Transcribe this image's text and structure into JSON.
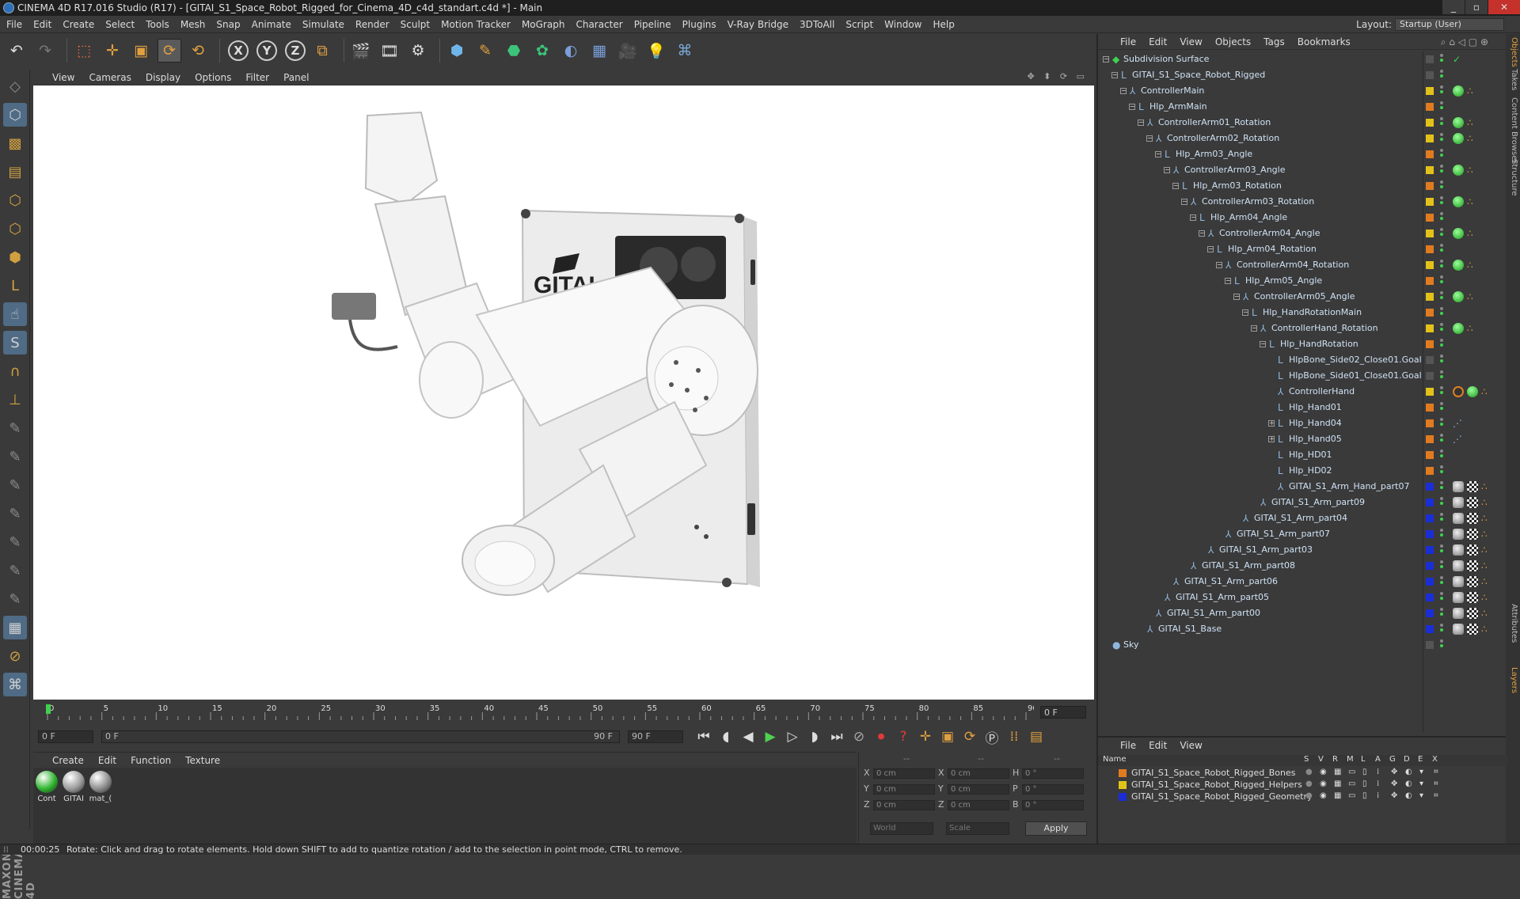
{
  "window": {
    "title": "CINEMA 4D R17.016 Studio (R17) - [GITAI_S1_Space_Robot_Rigged_for_Cinema_4D_c4d_standart.c4d *] - Main",
    "buttons": [
      "_",
      "▫",
      "✕"
    ]
  },
  "menubar": [
    "File",
    "Edit",
    "Create",
    "Select",
    "Tools",
    "Mesh",
    "Snap",
    "Animate",
    "Simulate",
    "Render",
    "Sculpt",
    "Motion Tracker",
    "MoGraph",
    "Character",
    "Pipeline",
    "Plugins",
    "V-Ray Bridge",
    "3DToAll",
    "Script",
    "Window",
    "Help"
  ],
  "layout": {
    "label": "Layout:",
    "value": "Startup (User)"
  },
  "viewport": {
    "menu": [
      "View",
      "Cameras",
      "Display",
      "Options",
      "Filter",
      "Panel"
    ],
    "icons": "✥ ⬍ ⟳ ▭"
  },
  "timeline": {
    "ticks": [
      "0",
      "5",
      "10",
      "15",
      "20",
      "25",
      "30",
      "35",
      "40",
      "45",
      "50",
      "55",
      "60",
      "65",
      "70",
      "75",
      "80",
      "85",
      "90"
    ],
    "end_frame": "0 F"
  },
  "transport": {
    "start": "0 F",
    "slider_left": "0 F",
    "slider_right": "90 F",
    "end": "90 F"
  },
  "materials": {
    "menu": [
      "Create",
      "Edit",
      "Function",
      "Texture"
    ],
    "items": [
      {
        "name": "Cont",
        "color": "#2fb52f"
      },
      {
        "name": "GITAI",
        "color": "#9a9a9a"
      },
      {
        "name": "mat_(",
        "color": "#8c8c8c"
      }
    ]
  },
  "coords": {
    "header": [
      "--",
      "--",
      "--"
    ],
    "rows": [
      {
        "a": "X",
        "av": "0 cm",
        "b": "X",
        "bv": "0 cm",
        "c": "H",
        "cv": "0 °"
      },
      {
        "a": "Y",
        "av": "0 cm",
        "b": "Y",
        "bv": "0 cm",
        "c": "P",
        "cv": "0 °"
      },
      {
        "a": "Z",
        "av": "0 cm",
        "b": "Z",
        "bv": "0 cm",
        "c": "B",
        "cv": "0 °"
      }
    ],
    "world": "World",
    "scale": "Scale",
    "apply": "Apply"
  },
  "status": {
    "time": "00:00:25",
    "text": "Rotate: Click and drag to rotate elements. Hold down SHIFT to add to quantize rotation / add to the selection in point mode, CTRL to remove."
  },
  "objects": {
    "menu": [
      "File",
      "Edit",
      "View",
      "Objects",
      "Tags",
      "Bookmarks"
    ],
    "rows": [
      {
        "name": "Subdivision Surface",
        "depth": 0,
        "toggle": "-",
        "icon": "◆",
        "layer": "",
        "tags": [
          "check"
        ]
      },
      {
        "name": "GITAI_S1_Space_Robot_Rigged",
        "depth": 1,
        "toggle": "-",
        "icon": "L",
        "layer": "",
        "tags": []
      },
      {
        "name": "ControllerMain",
        "depth": 2,
        "toggle": "-",
        "icon": "⅄",
        "layer": "#e2c21a",
        "tags": [
          "green",
          "dots"
        ]
      },
      {
        "name": "Hlp_ArmMain",
        "depth": 3,
        "toggle": "-",
        "icon": "L",
        "layer": "#e07b20",
        "tags": []
      },
      {
        "name": "ControllerArm01_Rotation",
        "depth": 4,
        "toggle": "-",
        "icon": "⅄",
        "layer": "#e2c21a",
        "tags": [
          "green",
          "dots"
        ]
      },
      {
        "name": "ControllerArm02_Rotation",
        "depth": 5,
        "toggle": "-",
        "icon": "⅄",
        "layer": "#e2c21a",
        "tags": [
          "green",
          "dots"
        ]
      },
      {
        "name": "Hlp_Arm03_Angle",
        "depth": 6,
        "toggle": "-",
        "icon": "L",
        "layer": "#e07b20",
        "tags": []
      },
      {
        "name": "ControllerArm03_Angle",
        "depth": 7,
        "toggle": "-",
        "icon": "⅄",
        "layer": "#e2c21a",
        "tags": [
          "green",
          "dots"
        ]
      },
      {
        "name": "Hlp_Arm03_Rotation",
        "depth": 8,
        "toggle": "-",
        "icon": "L",
        "layer": "#e07b20",
        "tags": []
      },
      {
        "name": "ControllerArm03_Rotation",
        "depth": 9,
        "toggle": "-",
        "icon": "⅄",
        "layer": "#e2c21a",
        "tags": [
          "green",
          "dots"
        ]
      },
      {
        "name": "Hlp_Arm04_Angle",
        "depth": 10,
        "toggle": "-",
        "icon": "L",
        "layer": "#e07b20",
        "tags": []
      },
      {
        "name": "ControllerArm04_Angle",
        "depth": 11,
        "toggle": "-",
        "icon": "⅄",
        "layer": "#e2c21a",
        "tags": [
          "green",
          "dots"
        ]
      },
      {
        "name": "Hlp_Arm04_Rotation",
        "depth": 12,
        "toggle": "-",
        "icon": "L",
        "layer": "#e07b20",
        "tags": []
      },
      {
        "name": "ControllerArm04_Rotation",
        "depth": 13,
        "toggle": "-",
        "icon": "⅄",
        "layer": "#e2c21a",
        "tags": [
          "green",
          "dots"
        ]
      },
      {
        "name": "Hlp_Arm05_Angle",
        "depth": 14,
        "toggle": "-",
        "icon": "L",
        "layer": "#e07b20",
        "tags": []
      },
      {
        "name": "ControllerArm05_Angle",
        "depth": 15,
        "toggle": "-",
        "icon": "⅄",
        "layer": "#e2c21a",
        "tags": [
          "green",
          "dots"
        ]
      },
      {
        "name": "Hlp_HandRotationMain",
        "depth": 16,
        "toggle": "-",
        "icon": "L",
        "layer": "#e07b20",
        "tags": []
      },
      {
        "name": "ControllerHand_Rotation",
        "depth": 17,
        "toggle": "-",
        "icon": "⅄",
        "layer": "#e2c21a",
        "tags": [
          "green",
          "dots"
        ]
      },
      {
        "name": "Hlp_HandRotation",
        "depth": 18,
        "toggle": "-",
        "icon": "L",
        "layer": "#e07b20",
        "tags": []
      },
      {
        "name": "HlpBone_Side02_Close01.Goal",
        "depth": 19,
        "toggle": "",
        "icon": "L",
        "layer": "",
        "tags": []
      },
      {
        "name": "HlpBone_Side01_Close01.Goal",
        "depth": 19,
        "toggle": "",
        "icon": "L",
        "layer": "",
        "tags": []
      },
      {
        "name": "ControllerHand",
        "depth": 19,
        "toggle": "",
        "icon": "⅄",
        "layer": "#e2c21a",
        "tags": [
          "no",
          "green",
          "dots"
        ]
      },
      {
        "name": "Hlp_Hand01",
        "depth": 19,
        "toggle": "",
        "icon": "L",
        "layer": "#e07b20",
        "tags": []
      },
      {
        "name": "Hlp_Hand04",
        "depth": 19,
        "toggle": "+",
        "icon": "L",
        "layer": "#e07b20",
        "tags": [
          "ik"
        ]
      },
      {
        "name": "Hlp_Hand05",
        "depth": 19,
        "toggle": "+",
        "icon": "L",
        "layer": "#e07b20",
        "tags": [
          "ik"
        ]
      },
      {
        "name": "Hlp_HD01",
        "depth": 19,
        "toggle": "",
        "icon": "L",
        "layer": "#e07b20",
        "tags": []
      },
      {
        "name": "Hlp_HD02",
        "depth": 19,
        "toggle": "",
        "icon": "L",
        "layer": "#e07b20",
        "tags": []
      },
      {
        "name": "GITAI_S1_Arm_Hand_part07",
        "depth": 19,
        "toggle": "",
        "icon": "⅄",
        "layer": "#1a2ed6",
        "tags": [
          "mat",
          "checker",
          "dots"
        ]
      },
      {
        "name": "GITAI_S1_Arm_part09",
        "depth": 17,
        "toggle": "",
        "icon": "⅄",
        "layer": "#1a2ed6",
        "tags": [
          "mat",
          "checker",
          "dots"
        ]
      },
      {
        "name": "GITAI_S1_Arm_part04",
        "depth": 15,
        "toggle": "",
        "icon": "⅄",
        "layer": "#1a2ed6",
        "tags": [
          "mat",
          "checker",
          "dots"
        ]
      },
      {
        "name": "GITAI_S1_Arm_part07",
        "depth": 13,
        "toggle": "",
        "icon": "⅄",
        "layer": "#1a2ed6",
        "tags": [
          "mat",
          "checker",
          "dots"
        ]
      },
      {
        "name": "GITAI_S1_Arm_part03",
        "depth": 11,
        "toggle": "",
        "icon": "⅄",
        "layer": "#1a2ed6",
        "tags": [
          "mat",
          "checker",
          "dots"
        ]
      },
      {
        "name": "GITAI_S1_Arm_part08",
        "depth": 9,
        "toggle": "",
        "icon": "⅄",
        "layer": "#1a2ed6",
        "tags": [
          "mat",
          "checker",
          "dots"
        ]
      },
      {
        "name": "GITAI_S1_Arm_part06",
        "depth": 7,
        "toggle": "",
        "icon": "⅄",
        "layer": "#1a2ed6",
        "tags": [
          "mat",
          "checker",
          "dots"
        ]
      },
      {
        "name": "GITAI_S1_Arm_part05",
        "depth": 6,
        "toggle": "",
        "icon": "⅄",
        "layer": "#1a2ed6",
        "tags": [
          "mat",
          "checker",
          "dots"
        ]
      },
      {
        "name": "GITAI_S1_Arm_part00",
        "depth": 5,
        "toggle": "",
        "icon": "⅄",
        "layer": "#1a2ed6",
        "tags": [
          "mat",
          "checker",
          "dots"
        ]
      },
      {
        "name": "GITAI_S1_Base",
        "depth": 4,
        "toggle": "",
        "icon": "⅄",
        "layer": "#1a2ed6",
        "tags": [
          "mat",
          "checker",
          "dots"
        ]
      },
      {
        "name": "Sky",
        "depth": 0,
        "toggle": "",
        "icon": "●",
        "layer": "",
        "tags": []
      }
    ]
  },
  "sidetabs": [
    "Objects",
    "Takes",
    "Content Browser",
    "Structure",
    "Attributes",
    "Layers"
  ],
  "layers": {
    "menu": [
      "File",
      "Edit",
      "View"
    ],
    "header": [
      "Name",
      "S",
      "V",
      "R",
      "M",
      "L",
      "A",
      "G",
      "D",
      "E",
      "X"
    ],
    "rows": [
      {
        "name": "GITAI_S1_Space_Robot_Rigged_Bones",
        "color": "#e07b20"
      },
      {
        "name": "GITAI_S1_Space_Robot_Rigged_Helpers",
        "color": "#e2c21a"
      },
      {
        "name": "GITAI_S1_Space_Robot_Rigged_Geometry",
        "color": "#1a2ed6"
      }
    ]
  },
  "model": {
    "logo_text": "GITAI"
  },
  "colors": {
    "accent": "#4f6b85",
    "green": "#2fb52f",
    "orange": "#e07b20",
    "yellow": "#e2c21a",
    "blue": "#1a2ed6"
  }
}
